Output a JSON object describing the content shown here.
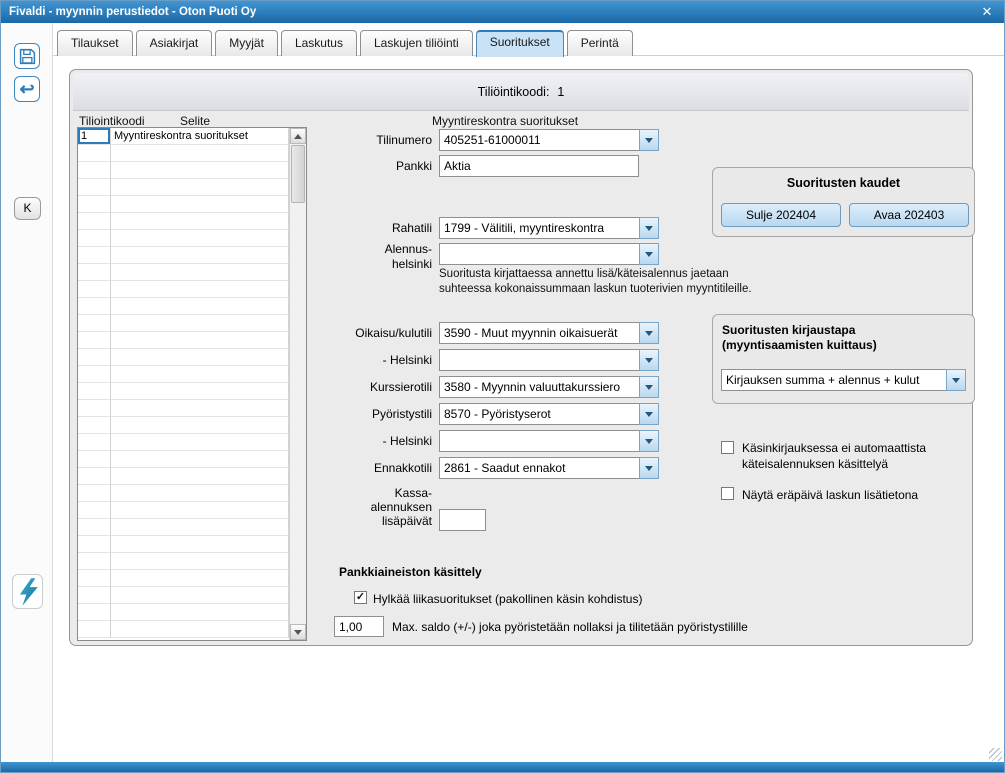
{
  "colors": {
    "titlebar_top": "#4195d2",
    "titlebar_bottom": "#1b68a6",
    "active_tab": "#c9e2f6",
    "button_face": "#b9d8ef",
    "selection_blue": "#2b7cba"
  },
  "titlebar": {
    "title": "Fivaldi - myynnin perustiedot - Oton Puoti Oy",
    "close_icon": "✕"
  },
  "tabs": {
    "active_index": 5,
    "items": [
      {
        "label": "Tilaukset"
      },
      {
        "label": "Asiakirjat"
      },
      {
        "label": "Myyjät"
      },
      {
        "label": "Laskutus"
      },
      {
        "label": "Laskujen tiliöinti"
      },
      {
        "label": "Suoritukset"
      },
      {
        "label": "Perintä"
      }
    ]
  },
  "sidebar": {
    "k_button": "K"
  },
  "panel": {
    "header_label": "Tiliöintikoodi:",
    "header_value": "1",
    "columns": {
      "code": "Tiliointikoodi",
      "selite": "Selite"
    },
    "form_title": "Myyntireskontra suoritukset",
    "table": {
      "rows": [
        {
          "code": "1",
          "selite": "Myyntireskontra suoritukset",
          "selected": true
        }
      ],
      "empty_row_count": 29
    }
  },
  "form": {
    "tilinumero": {
      "label": "Tilinumero",
      "value": "405251-61000011"
    },
    "pankki": {
      "label": "Pankki",
      "value": "Aktia"
    },
    "rahatili": {
      "label": "Rahatili",
      "value": "1799 - Välitili, myyntireskontra"
    },
    "alennus": {
      "label_line1": "Alennus-",
      "label_line2": "helsinki",
      "value": "",
      "help_line1": "Suoritusta kirjattaessa annettu lisä/käteisalennus jaetaan",
      "help_line2": "suhteessa kokonaissummaan laskun tuoterivien myyntitileille."
    },
    "oikaisu": {
      "label": "Oikaisu/kulutili",
      "value": "3590 - Muut myynnin oikaisuerät"
    },
    "helsinki1": {
      "label": "- Helsinki",
      "value": ""
    },
    "kurssierotili": {
      "label": "Kurssierotili",
      "value": "3580 - Myynnin valuuttakurssiero"
    },
    "pyoristystili": {
      "label": "Pyöristystili",
      "value": "8570 - Pyöristyserot"
    },
    "helsinki2": {
      "label": "- Helsinki",
      "value": ""
    },
    "ennakkotili": {
      "label": "Ennakkotili",
      "value": "2861 - Saadut ennakot"
    },
    "kassa": {
      "label_line1": "Kassa-",
      "label_line2": "alennuksen",
      "label_line3": "lisäpäivät",
      "value": ""
    }
  },
  "kaudet": {
    "title": "Suoritusten kaudet",
    "close_button": "Sulje 202404",
    "open_button": "Avaa 202403"
  },
  "kirjaustapa": {
    "title_line1": "Suoritusten kirjaustapa",
    "title_line2": "(myyntisaamisten kuittaus)",
    "value": "Kirjauksen summa + alennus + kulut"
  },
  "checkboxes": {
    "kasinkirjaus": {
      "label_line1": "Käsinkirjauksessa ei automaattista",
      "label_line2": "käteisalennuksen käsittelyä",
      "checked": false
    },
    "nayta_erapaiva": {
      "label": "Näytä eräpäivä laskun lisätietona",
      "checked": false
    },
    "hylkaa": {
      "label": "Hylkää liikasuoritukset (pakollinen käsin kohdistus)",
      "checked": true
    }
  },
  "pankkiaineisto": {
    "heading": "Pankkiaineiston käsittely",
    "max_saldo_value": "1,00",
    "max_saldo_label": "Max. saldo (+/-) joka pyöristetään nollaksi ja tilitetään pyöristystilille"
  }
}
